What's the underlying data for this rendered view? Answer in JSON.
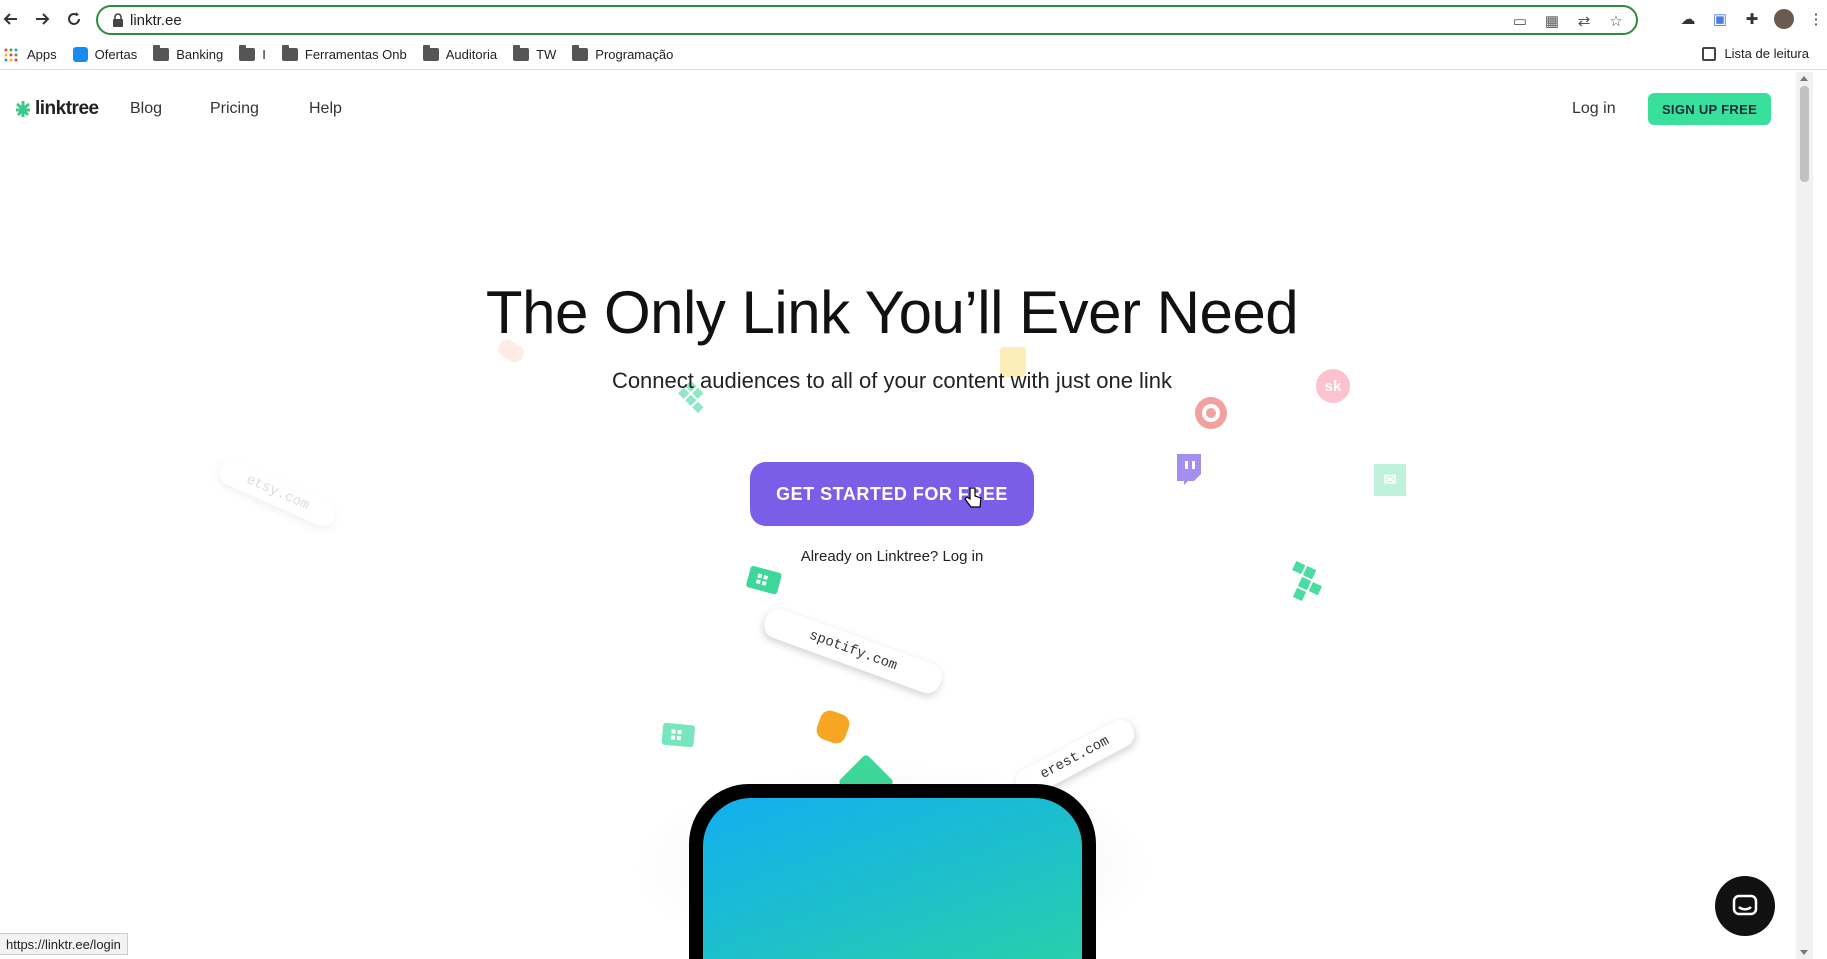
{
  "browser": {
    "url": "linktr.ee",
    "bookmarks": [
      {
        "label": "Apps",
        "icon": "apps-grid-icon"
      },
      {
        "label": "Ofertas",
        "icon": "ofertas-icon"
      },
      {
        "label": "Banking",
        "icon": "folder-icon"
      },
      {
        "label": "I",
        "icon": "folder-icon"
      },
      {
        "label": "Ferramentas Onb",
        "icon": "folder-icon"
      },
      {
        "label": "Auditoria",
        "icon": "folder-icon"
      },
      {
        "label": "TW",
        "icon": "folder-icon"
      },
      {
        "label": "Programação",
        "icon": "folder-icon"
      }
    ],
    "reading_list": "Lista de leitura",
    "status_url": "https://linktr.ee/login"
  },
  "site": {
    "logo": "linktree",
    "nav": {
      "blog": "Blog",
      "pricing": "Pricing",
      "help": "Help"
    },
    "login": "Log in",
    "signup": "SIGN UP FREE"
  },
  "hero": {
    "title": "The Only Link You’ll Ever Need",
    "subtitle": "Connect audiences to all of your content with just one link",
    "cta": "GET STARTED FOR FREE",
    "already": "Already on Linktree? Log in"
  },
  "floating_links": {
    "etsy": "etsy.com",
    "spotify": "spotify.com",
    "pinterest": "erest.com"
  },
  "colors": {
    "accent_green": "#39e09b",
    "cta_purple": "#7b5ee8",
    "omnibox_border": "#2e8b3f"
  }
}
